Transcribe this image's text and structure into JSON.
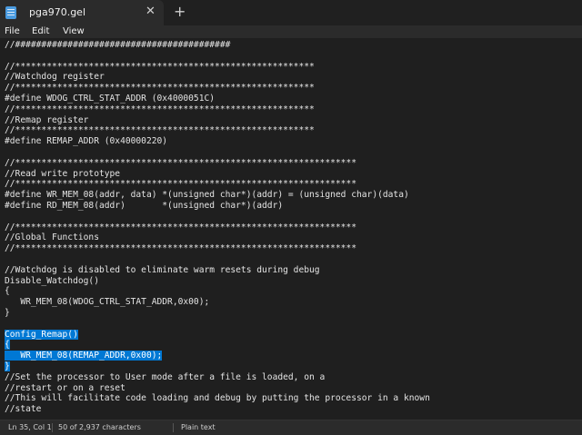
{
  "window": {
    "tab_title": "pga970.gel",
    "close_glyph": "✕",
    "new_tab_glyph": "+"
  },
  "menu": [
    "File",
    "Edit",
    "View"
  ],
  "editor": {
    "lines": [
      "//#########################################",
      "",
      "//*********************************************************",
      "//Watchdog register",
      "//*********************************************************",
      "#define WDOG_CTRL_STAT_ADDR (0x4000051C)",
      "//*********************************************************",
      "//Remap register",
      "//*********************************************************",
      "#define REMAP_ADDR (0x40000220)",
      "",
      "//*****************************************************************",
      "//Read write prototype",
      "//*****************************************************************",
      "#define WR_MEM_08(addr, data) *(unsigned char*)(addr) = (unsigned char)(data)",
      "#define RD_MEM_08(addr)       *(unsigned char*)(addr)",
      "",
      "//*****************************************************************",
      "//Global Functions",
      "//*****************************************************************",
      "",
      "//Watchdog is disabled to eliminate warm resets during debug",
      "Disable_Watchdog()",
      "{",
      "   WR_MEM_08(WDOG_CTRL_STAT_ADDR,0x00);",
      "}",
      "",
      "Config_Remap()",
      "{",
      "   WR_MEM_08(REMAP_ADDR,0x00);",
      "}",
      "//Set the processor to User mode after a file is loaded, on a",
      "//restart or on a reset",
      "//This will facilitate code loading and debug by putting the processor in a known",
      "//state"
    ],
    "selected_line_numbers": [
      28,
      29,
      30,
      31
    ]
  },
  "status": {
    "position": "Ln 35, Col 1",
    "characters": "50 of 2,937 characters",
    "format": "Plain text"
  },
  "colors": {
    "background": "#1f1f1f",
    "selection": "#0078d4",
    "chrome": "#2b2b2b"
  }
}
